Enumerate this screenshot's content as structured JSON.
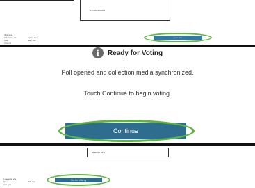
{
  "top_strip": {
    "box_text": "Ро осы в соа№",
    "meta_left": [
      "Эла зна",
      "2 атласы аж",
      "сын",
      "тала эт"
    ],
    "meta_mid": [
      "ша за жыл",
      "жыл кое"
    ],
    "button_text": "у на лоа"
  },
  "modal": {
    "title": "Ready for Voting",
    "message1": "Poll opened and collection media synchronized.",
    "message2": "Touch Continue to begin voting.",
    "continue_label": "Continue",
    "icon": "info-icon"
  },
  "bottom_strip": {
    "box_text": "за вопро ра а",
    "meta_left": [
      "с вы ала ала",
      "все а",
      "ала ада"
    ],
    "meta_mid": [
      "Мо коо"
    ],
    "button_text": "Go to Voting"
  },
  "colors": {
    "highlight": "#5db73e",
    "button_blue": "#2f6d8f",
    "divider": "#111111"
  }
}
